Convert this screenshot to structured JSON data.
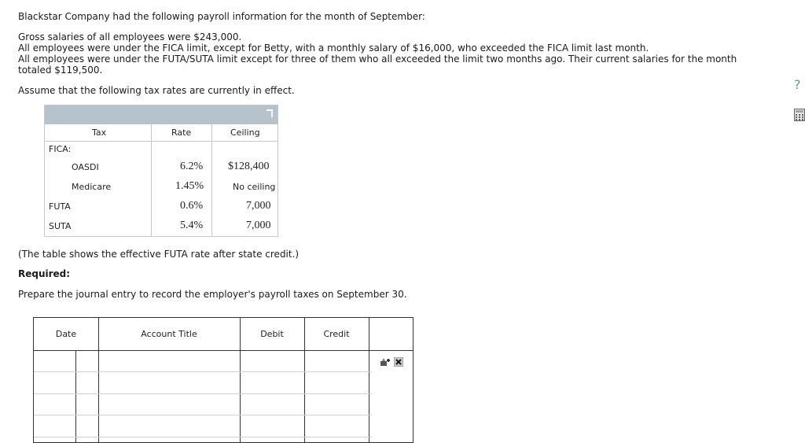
{
  "intro": "Blackstar Company had the following payroll information for the month of September:",
  "facts": [
    "Gross salaries of all employees were $243,000.",
    "All employees were under the FICA limit, except for Betty, with a monthly salary of $16,000, who exceeded the FICA limit last month.",
    "All employees were under the FUTA/SUTA limit except for three of them who all exceeded the limit two months ago. Their current salaries for the month totaled $119,500."
  ],
  "assume": "Assume that the following tax rates are currently in effect.",
  "tax_table": {
    "headers": {
      "tax": "Tax",
      "rate": "Rate",
      "ceiling": "Ceiling"
    },
    "fica_label": "FICA:",
    "rows": [
      {
        "name": "OASDI",
        "rate": "6.2%",
        "ceiling": "$128,400"
      },
      {
        "name": "Medicare",
        "rate": "1.45%",
        "ceiling": "No ceiling"
      },
      {
        "name": "FUTA",
        "rate": "0.6%",
        "ceiling": "7,000"
      },
      {
        "name": "SUTA",
        "rate": "5.4%",
        "ceiling": "7,000"
      }
    ]
  },
  "note": "(The table shows the effective FUTA rate after state credit.)",
  "required_label": "Required:",
  "task": "Prepare the journal entry to record the employer's payroll taxes on September 30.",
  "journal": {
    "headers": {
      "date": "Date",
      "account": "Account Title",
      "debit": "Debit",
      "credit": "Credit"
    }
  },
  "side_icons": {
    "help": "?",
    "calculator": "calculator-icon"
  },
  "colors": {
    "table_band": "#b7c3cc",
    "help_icon": "#6a8fb0"
  }
}
